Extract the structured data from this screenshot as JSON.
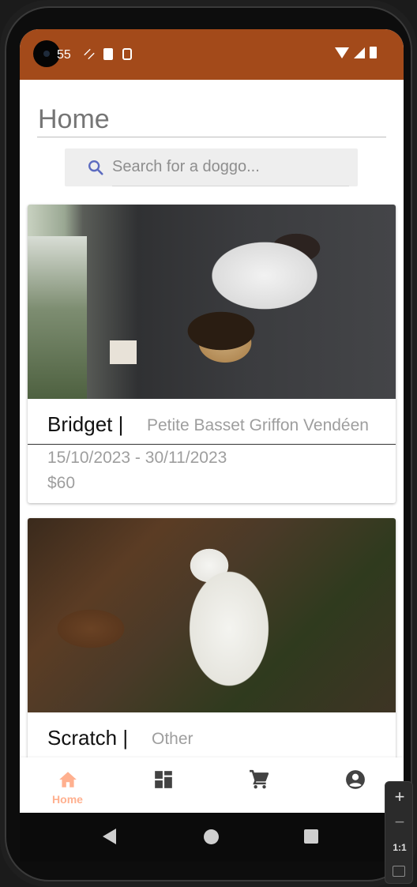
{
  "status_bar": {
    "time": "55",
    "color": "#a34a1a"
  },
  "page": {
    "title": "Home"
  },
  "search": {
    "placeholder": "Search for a doggo...",
    "icon": "search-icon",
    "icon_color": "#5c6bc0"
  },
  "listings": [
    {
      "name": "Bridget |",
      "breed": "Petite Basset Griffon Vendéen",
      "dates": "15/10/2023 - 30/11/2023",
      "price": "$60"
    },
    {
      "name": "Scratch |",
      "breed": "Other"
    }
  ],
  "bottom_nav": {
    "items": [
      {
        "label": "Home",
        "icon": "home-icon",
        "active": true
      },
      {
        "icon": "dashboard-icon",
        "active": false
      },
      {
        "icon": "cart-icon",
        "active": false
      },
      {
        "icon": "account-icon",
        "active": false
      }
    ],
    "active_color": "#ffb08f",
    "inactive_color": "#424242"
  },
  "emulator_zoom": {
    "zoom_in": "+",
    "zoom_out": "−",
    "reset": "1:1"
  }
}
